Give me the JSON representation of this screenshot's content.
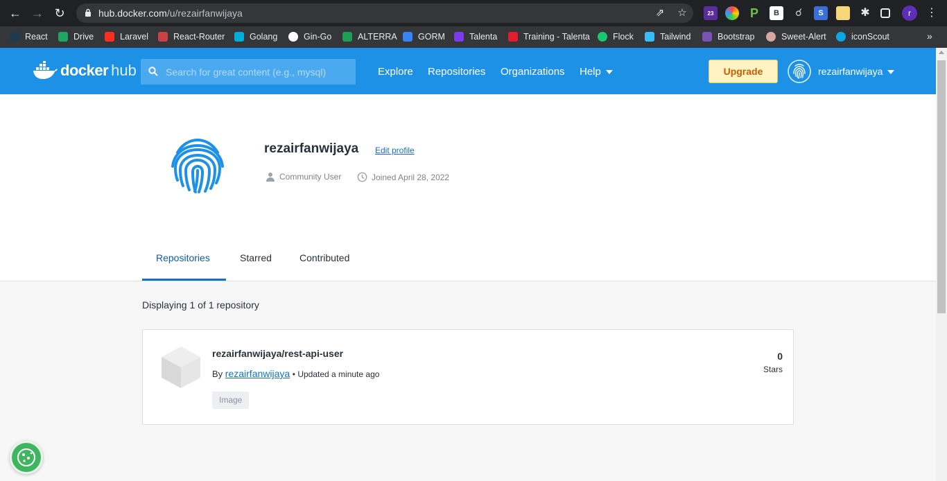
{
  "browser": {
    "url_host": "hub.docker.com",
    "url_path": "/u/rezairfanwijaya",
    "profile_initial": "r",
    "extension_badge": "23",
    "bookmarks": [
      {
        "label": "React",
        "color": "#1e3a4c"
      },
      {
        "label": "Drive",
        "color": "#1fa463"
      },
      {
        "label": "Laravel",
        "color": "#ff2d20"
      },
      {
        "label": "React-Router",
        "color": "#ca4245"
      },
      {
        "label": "Golang",
        "color": "#00add8"
      },
      {
        "label": "Gin-Go",
        "color": "#ffffff"
      },
      {
        "label": "ALTERRA",
        "color": "#1f9d55"
      },
      {
        "label": "GORM",
        "color": "#3b82f6"
      },
      {
        "label": "Talenta",
        "color": "#7c3aed"
      },
      {
        "label": "Training - Talenta",
        "color": "#e11d2e"
      },
      {
        "label": "Flock",
        "color": "#18c76f"
      },
      {
        "label": "Tailwind",
        "color": "#38bdf8"
      },
      {
        "label": "Bootstrap",
        "color": "#7952b3"
      },
      {
        "label": "Sweet-Alert",
        "color": "#d8a7a0"
      },
      {
        "label": "iconScout",
        "color": "#0ea5e9"
      }
    ]
  },
  "header": {
    "logo_text": "docker",
    "logo_sub": "hub",
    "search_placeholder": "Search for great content (e.g., mysql)",
    "nav": [
      "Explore",
      "Repositories",
      "Organizations",
      "Help"
    ],
    "upgrade_label": "Upgrade",
    "username": "rezairfanwijaya"
  },
  "profile": {
    "name": "rezairfanwijaya",
    "edit_label": "Edit profile",
    "user_type": "Community User",
    "joined": "Joined April 28, 2022",
    "tabs": [
      "Repositories",
      "Starred",
      "Contributed"
    ],
    "active_tab": "Repositories"
  },
  "content": {
    "display_text": "Displaying 1 of 1 repository",
    "repo": {
      "name": "rezairfanwijaya/rest-api-user",
      "by_prefix": "By",
      "owner": "rezairfanwijaya",
      "updated": "• Updated a minute ago",
      "badge": "Image",
      "stars_count": "0",
      "stars_label": "Stars"
    }
  },
  "colors": {
    "docker_blue": "#1d91e6",
    "link_blue": "#1173c2",
    "upgrade_bg": "#fff3c4"
  }
}
